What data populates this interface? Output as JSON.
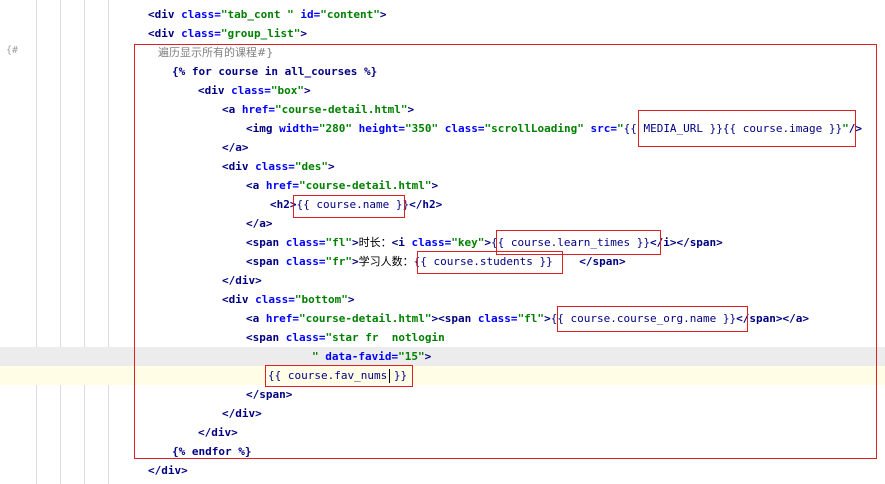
{
  "editor": {
    "gutter_marker": "{#",
    "lines": [
      {
        "tokens": [
          [
            "tag",
            "<div "
          ],
          [
            "an",
            "class="
          ],
          [
            "av",
            "\"tab_cont \" "
          ],
          [
            "an",
            "id="
          ],
          [
            "av",
            "\"content\""
          ],
          [
            "tag",
            ">"
          ]
        ]
      },
      {
        "tokens": [
          [
            "tag",
            "<div "
          ],
          [
            "an",
            "class="
          ],
          [
            "av",
            "\"group_list\""
          ],
          [
            "tag",
            ">"
          ]
        ]
      },
      {
        "tokens": [
          [
            "cn",
            "遍历显示所有的课程#}"
          ]
        ]
      },
      {
        "tokens": [
          [
            "tmpl",
            "{% for course in all_courses %}"
          ]
        ]
      },
      {
        "tokens": [
          [
            "tag",
            "<div "
          ],
          [
            "an",
            "class="
          ],
          [
            "av",
            "\"box\""
          ],
          [
            "tag",
            ">"
          ]
        ]
      },
      {
        "tokens": [
          [
            "tag",
            "<a "
          ],
          [
            "an",
            "href="
          ],
          [
            "av",
            "\"course-detail.html\""
          ],
          [
            "tag",
            ">"
          ]
        ]
      },
      {
        "tokens": [
          [
            "tag",
            "<img "
          ],
          [
            "an",
            "width="
          ],
          [
            "av",
            "\"280\" "
          ],
          [
            "an",
            "height="
          ],
          [
            "av",
            "\"350\" "
          ],
          [
            "an",
            "class="
          ],
          [
            "av",
            "\"scrollLoading\" "
          ],
          [
            "an",
            "src="
          ],
          [
            "av",
            "\""
          ],
          [
            "vr",
            "{{ MEDIA_URL }}{{ course.image }}"
          ],
          [
            "av",
            "\""
          ],
          [
            "tag",
            "/>"
          ]
        ]
      },
      {
        "tokens": [
          [
            "tag",
            "</a>"
          ]
        ]
      },
      {
        "tokens": [
          [
            "tag",
            "<div "
          ],
          [
            "an",
            "class="
          ],
          [
            "av",
            "\"des\""
          ],
          [
            "tag",
            ">"
          ]
        ]
      },
      {
        "tokens": [
          [
            "tag",
            "<a "
          ],
          [
            "an",
            "href="
          ],
          [
            "av",
            "\"course-detail.html\""
          ],
          [
            "tag",
            ">"
          ]
        ]
      },
      {
        "tokens": [
          [
            "tag",
            "<h2>"
          ],
          [
            "vr",
            "{{ course.name }}"
          ],
          [
            "tag",
            "</h2>"
          ]
        ]
      },
      {
        "tokens": [
          [
            "tag",
            "</a>"
          ]
        ]
      },
      {
        "tokens": [
          [
            "tag",
            "<span "
          ],
          [
            "an",
            "class="
          ],
          [
            "av",
            "\"fl\""
          ],
          [
            "tag",
            ">"
          ],
          [
            "tx",
            "时长："
          ],
          [
            "tag",
            "<i "
          ],
          [
            "an",
            "class="
          ],
          [
            "av",
            "\"key\""
          ],
          [
            "tag",
            ">"
          ],
          [
            "vr",
            "{{ course.learn_times }}"
          ],
          [
            "tag",
            "</i></span>"
          ]
        ]
      },
      {
        "tokens": [
          [
            "tag",
            "<span "
          ],
          [
            "an",
            "class="
          ],
          [
            "av",
            "\"fr\""
          ],
          [
            "tag",
            ">"
          ],
          [
            "tx",
            "学习人数："
          ],
          [
            "vr",
            "{{ course.students }}"
          ],
          [
            "tx",
            "    "
          ],
          [
            "tag",
            "</span>"
          ]
        ]
      },
      {
        "tokens": [
          [
            "tag",
            "</div>"
          ]
        ]
      },
      {
        "tokens": [
          [
            "tag",
            "<div "
          ],
          [
            "an",
            "class="
          ],
          [
            "av",
            "\"bottom\""
          ],
          [
            "tag",
            ">"
          ]
        ]
      },
      {
        "tokens": [
          [
            "tag",
            "<a "
          ],
          [
            "an",
            "href="
          ],
          [
            "av",
            "\"course-detail.html\""
          ],
          [
            "tag",
            "><span "
          ],
          [
            "an",
            "class="
          ],
          [
            "av",
            "\"fl\""
          ],
          [
            "tag",
            ">"
          ],
          [
            "vr",
            "{{ course.course_org.name }}"
          ],
          [
            "tag",
            "</span></a>"
          ]
        ]
      },
      {
        "tokens": [
          [
            "tag",
            "<span "
          ],
          [
            "an",
            "class="
          ],
          [
            "av",
            "\"star fr  notlogin"
          ]
        ]
      },
      {
        "tokens": [
          [
            "av",
            "\" "
          ],
          [
            "an",
            "data-favid="
          ],
          [
            "av",
            "\"15\""
          ],
          [
            "tag",
            ">"
          ]
        ]
      },
      {
        "tokens": [
          [
            "vr",
            "{{ course.fav_nums }}"
          ]
        ]
      },
      {
        "tokens": [
          [
            "tag",
            "</span>"
          ]
        ]
      },
      {
        "tokens": [
          [
            "tag",
            "</div>"
          ]
        ]
      },
      {
        "tokens": [
          [
            "tag",
            "</div>"
          ]
        ]
      },
      {
        "tokens": [
          [
            "tmpl",
            "{% endfor %}"
          ]
        ]
      },
      {
        "tokens": [
          [
            "tag",
            "</div>"
          ]
        ]
      }
    ]
  }
}
